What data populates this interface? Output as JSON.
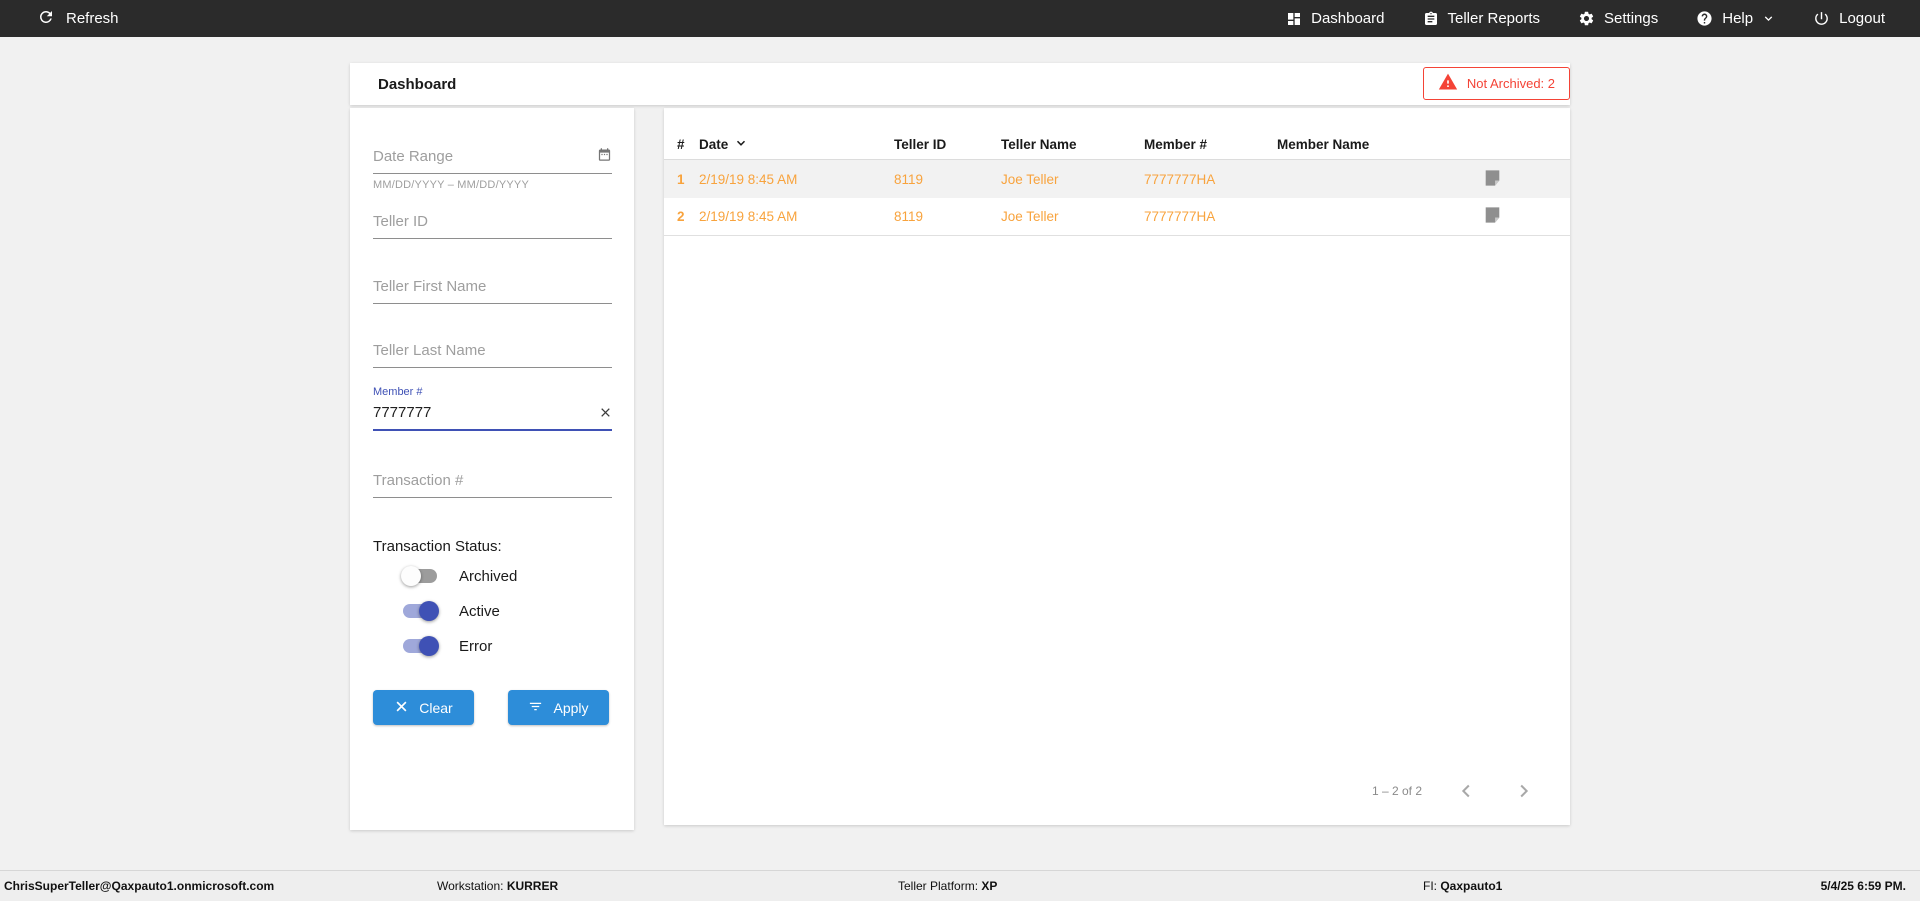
{
  "topbar": {
    "refresh_label": "Refresh",
    "items": [
      {
        "label": "Dashboard",
        "icon": "dashboard-grid-icon"
      },
      {
        "label": "Teller Reports",
        "icon": "clipboard-icon"
      },
      {
        "label": "Settings",
        "icon": "gear-icon"
      },
      {
        "label": "Help",
        "icon": "help-icon",
        "has_dropdown": true
      },
      {
        "label": "Logout",
        "icon": "power-icon"
      }
    ]
  },
  "page": {
    "title": "Dashboard",
    "alert_badge": {
      "label": "Not Archived: 2",
      "color": "#f44336"
    }
  },
  "filters": {
    "date_range": {
      "placeholder": "Date Range",
      "format_hint": "MM/DD/YYYY – MM/DD/YYYY"
    },
    "teller_id": {
      "placeholder": "Teller ID"
    },
    "teller_first_name": {
      "placeholder": "Teller First Name"
    },
    "teller_last_name": {
      "placeholder": "Teller Last Name"
    },
    "member_number": {
      "label": "Member #",
      "value": "7777777"
    },
    "transaction_number": {
      "placeholder": "Transaction #"
    },
    "transaction_status": {
      "label": "Transaction Status:",
      "toggles": [
        {
          "label": "Archived",
          "on": false
        },
        {
          "label": "Active",
          "on": true
        },
        {
          "label": "Error",
          "on": true
        }
      ]
    },
    "buttons": {
      "clear": "Clear",
      "apply": "Apply"
    }
  },
  "table": {
    "columns": [
      "#",
      "Date",
      "Teller ID",
      "Teller Name",
      "Member #",
      "Member Name"
    ],
    "sort_column": "Date",
    "rows": [
      {
        "num": "1",
        "date": "2/19/19 8:45 AM",
        "teller_id": "8119",
        "teller_name": "Joe Teller",
        "member_number": "7777777HA",
        "member_name": ""
      },
      {
        "num": "2",
        "date": "2/19/19 8:45 AM",
        "teller_id": "8119",
        "teller_name": "Joe Teller",
        "member_number": "7777777HA",
        "member_name": ""
      }
    ],
    "pagination": {
      "range_label": "1 – 2 of 2"
    }
  },
  "statusbar": {
    "user": "ChrisSuperTeller@Qaxpauto1.onmicrosoft.com",
    "workstation_label": "Workstation: ",
    "workstation": "KURRER",
    "platform_label": "Teller Platform: ",
    "platform": "XP",
    "fi_label": "FI: ",
    "fi": "Qaxpauto1",
    "datetime": "5/4/25 6:59 PM."
  },
  "colors": {
    "topbar_bg": "#2b2b2b",
    "accent_blue": "#2d8dd9",
    "row_orange": "#f8a33d",
    "alert_red": "#f44336",
    "indigo": "#3f51b5"
  }
}
